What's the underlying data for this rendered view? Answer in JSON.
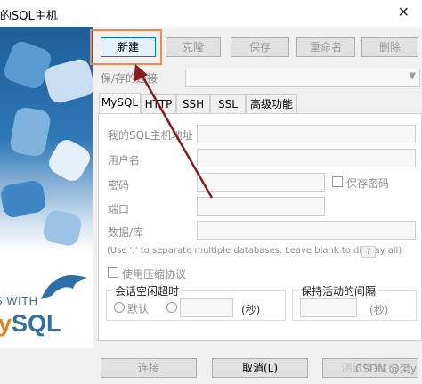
{
  "window": {
    "title": "的SQL主机",
    "close_glyph": "✕"
  },
  "banner": {
    "with_text": "S WITH",
    "logo_a": "y",
    "logo_b": "SQL"
  },
  "toolbar": {
    "new": "新建",
    "clone": "克隆",
    "save": "保存",
    "rename": "重命名",
    "delete": "删除"
  },
  "saved": {
    "label": "保/存的连接",
    "value": ""
  },
  "tabs": [
    "MySQL",
    "HTTP",
    "SSH",
    "SSL",
    "高级功能"
  ],
  "form": {
    "host_label": "我的SQL主机地址",
    "user_label": "用户名",
    "password_label": "密码",
    "save_password_label": "保存密码",
    "port_label": "端口",
    "db_label": "数据/库",
    "db_hint": "(Use ';' to separate multiple databases. Leave blank to display all)",
    "help_btn": "?",
    "compress_label": "使用压缩协议",
    "timeout_group": "会话空闲超时",
    "default_label": "默认",
    "seconds_label": "(秒)",
    "keepalive_group": "保持活动的间隔",
    "keepalive_seconds": "(秒)"
  },
  "footer": {
    "connect": "连接",
    "cancel": "取消(L)",
    "test": "测试连接(E)"
  },
  "watermark": "CSDN @樊y",
  "colors": {
    "highlight": "#f08a4b",
    "arrow": "#8b1a1a"
  }
}
